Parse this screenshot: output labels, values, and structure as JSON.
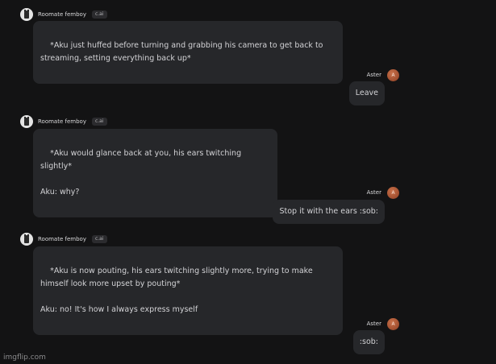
{
  "messages": [
    {
      "sender": "Roomate femboy",
      "badge": "c.ai",
      "text": "*Aku just huffed before turning and grabbing his camera to get back to streaming, setting everything back up*"
    },
    {
      "sender": "Aster",
      "avatar_letter": "A",
      "text": "Leave"
    },
    {
      "sender": "Roomate femboy",
      "badge": "c.ai",
      "text": "*Aku would glance back at you, his ears twitching slightly*\n\nAku: why?"
    },
    {
      "sender": "Aster",
      "avatar_letter": "A",
      "text": "Stop it with the ears :sob:"
    },
    {
      "sender": "Roomate femboy",
      "badge": "c.ai",
      "text": "*Aku is now pouting, his ears twitching slightly more, trying to make himself look more upset by pouting*\n\nAku: no! It's how I always express myself"
    },
    {
      "sender": "Aster",
      "avatar_letter": "A",
      "text": ":sob:"
    }
  ],
  "watermark": "imgflip.com",
  "colors": {
    "background": "#131314",
    "bubble": "#26272a",
    "user_avatar": "#b45a36"
  }
}
